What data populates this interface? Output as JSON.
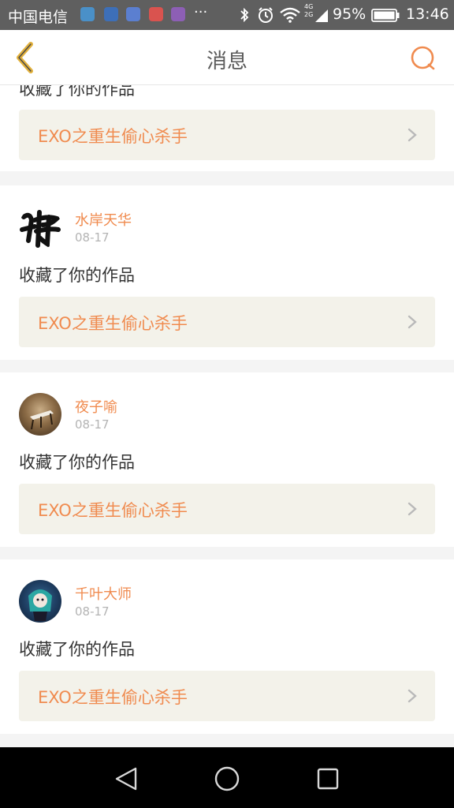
{
  "status_bar": {
    "carrier": "中国电信",
    "more": "···",
    "network": "4G 2G",
    "battery": "95%",
    "time": "13:46"
  },
  "header": {
    "title": "消息"
  },
  "feed": {
    "top_partial_action": "收藏了你的作品",
    "top_partial_work": "EXO之重生偷心杀手",
    "items": [
      {
        "username": "水岸天华",
        "date": "08-17",
        "action": "收藏了你的作品",
        "work": "EXO之重生偷心杀手"
      },
      {
        "username": "夜子喻",
        "date": "08-17",
        "action": "收藏了你的作品",
        "work": "EXO之重生偷心杀手"
      },
      {
        "username": "千叶大师",
        "date": "08-17",
        "action": "收藏了你的作品",
        "work": "EXO之重生偷心杀手"
      }
    ]
  },
  "colors": {
    "accent": "#f08b4f",
    "back_arrow": "#e2b13c",
    "card_bg": "#f3f2ea",
    "status_bar_bg": "#5f5f5f"
  }
}
